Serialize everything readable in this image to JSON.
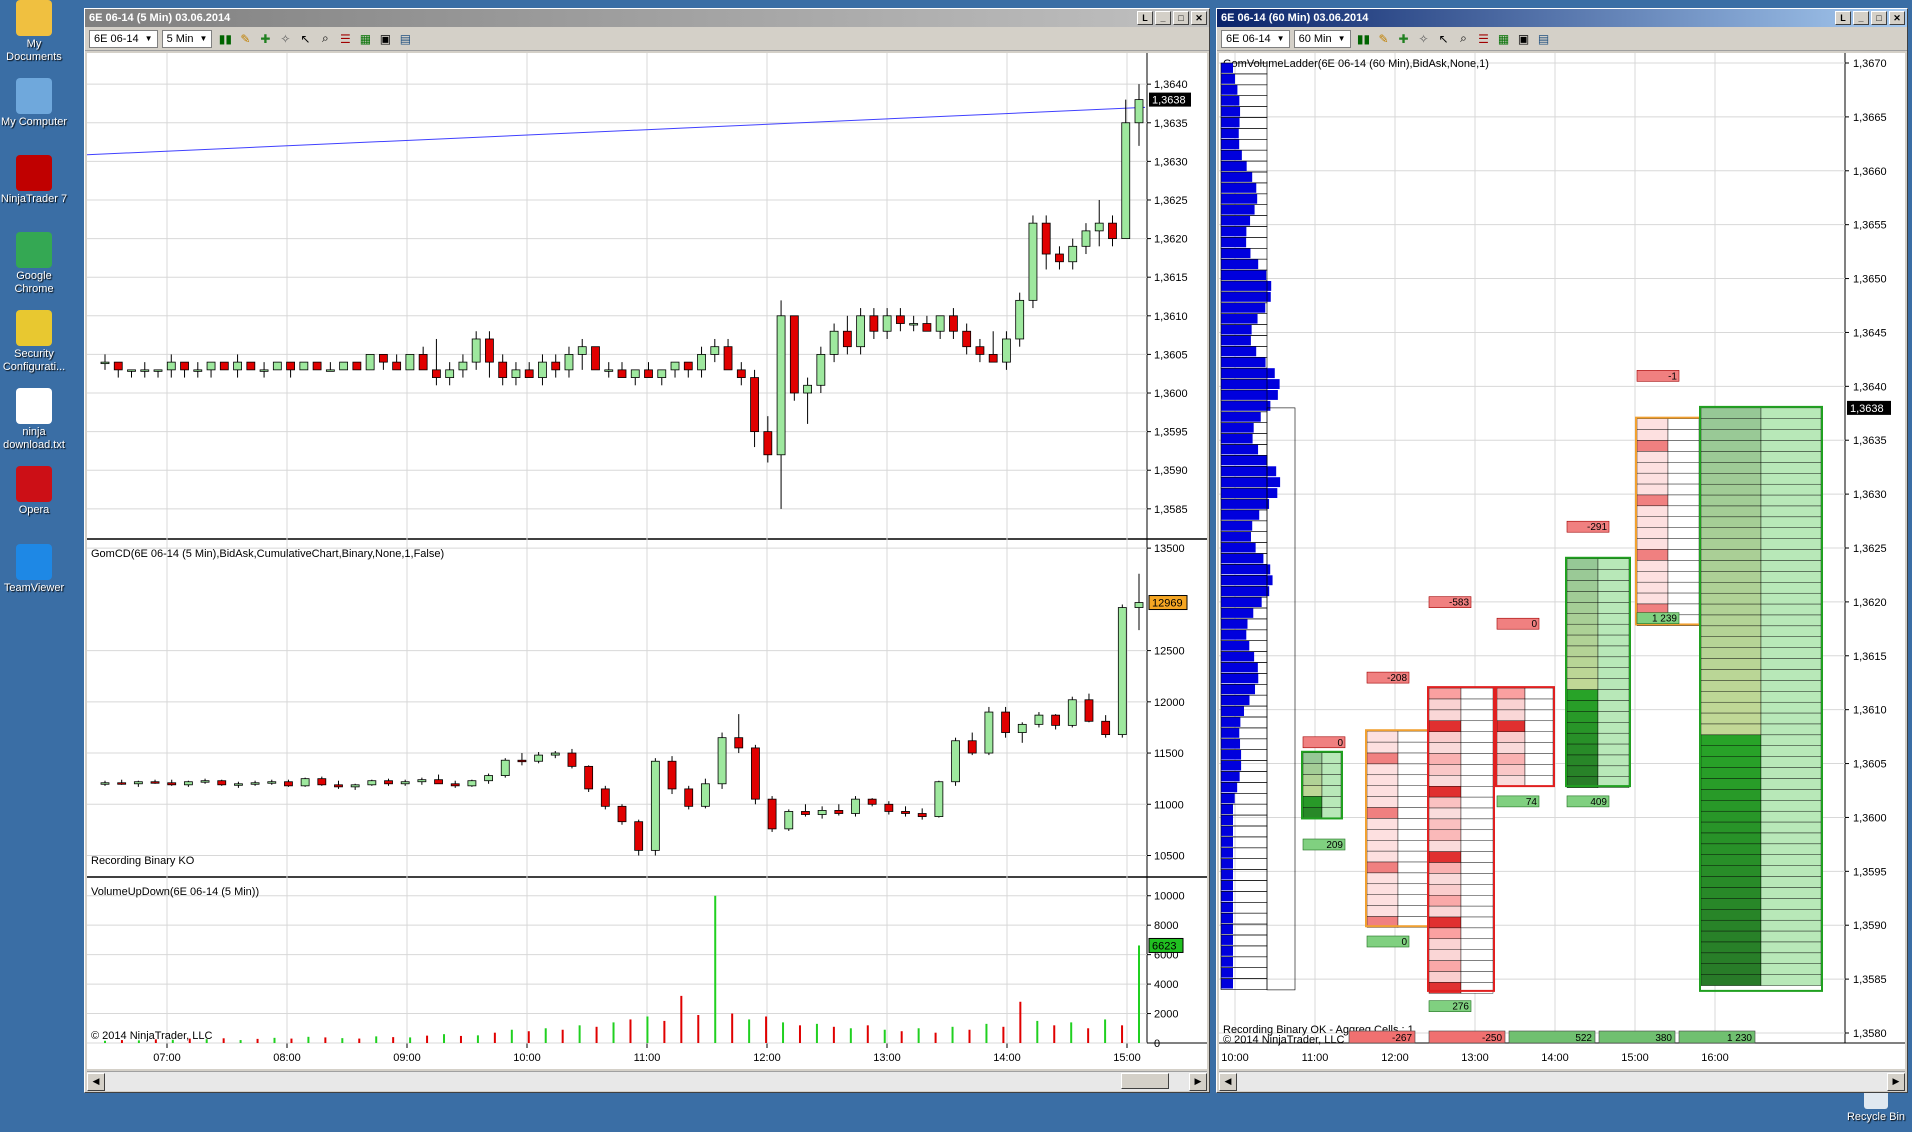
{
  "desktop": {
    "icons": [
      {
        "label": "My Documents",
        "color": "#f0c040",
        "top": -20
      },
      {
        "label": "My Computer",
        "color": "#6fa8dc",
        "top": 58
      },
      {
        "label": "NinjaTrader 7",
        "color": "#c00000",
        "top": 135
      },
      {
        "label": "Google Chrome",
        "color": "#34a853",
        "top": 212
      },
      {
        "label": "Security Configurati...",
        "color": "#e8c830",
        "top": 290
      },
      {
        "label": "ninja download.txt",
        "color": "#ffffff",
        "top": 368
      },
      {
        "label": "Opera",
        "color": "#cc0f16",
        "top": 446
      },
      {
        "label": "TeamViewer",
        "color": "#1e88e5",
        "top": 524
      }
    ],
    "recycle_bin": "Recycle Bin"
  },
  "left_window": {
    "title": "6E 06-14 (5 Min)  03.06.2014",
    "instrument": "6E 06-14",
    "interval": "5 Min",
    "price_panel": {
      "price_ticks": [
        "1,3640",
        "1,3635",
        "1,3630",
        "1,3625",
        "1,3620",
        "1,3615",
        "1,3610",
        "1,3605",
        "1,3600",
        "1,3595",
        "1,3590",
        "1,3585"
      ],
      "last_price": "1,3638",
      "ylim": [
        1.3582,
        1.3643
      ]
    },
    "cd_panel": {
      "label": "GomCD(6E 06-14 (5 Min),BidAsk,CumulativeChart,Binary,None,1,False)",
      "status": "Recording Binary KO",
      "ticks": [
        "13500",
        "12500",
        "12000",
        "11500",
        "11000",
        "10500"
      ],
      "last_value": "12969",
      "ylim": [
        10300,
        13550
      ]
    },
    "vol_panel": {
      "label": "VolumeUpDown(6E 06-14 (5 Min))",
      "ticks": [
        "10000",
        "8000",
        "6000",
        "4000",
        "2000",
        "0"
      ],
      "last_value": "6623",
      "copyright": "© 2014 NinjaTrader, LLC",
      "ylim": [
        0,
        11000
      ]
    },
    "time_labels": [
      "07:00",
      "08:00",
      "09:00",
      "10:00",
      "11:00",
      "12:00",
      "13:00",
      "14:00",
      "15:00"
    ]
  },
  "right_window": {
    "title": "6E 06-14 (60 Min)  03.06.2014",
    "instrument": "6E 06-14",
    "interval": "60 Min",
    "indicator_label": "GomVolumeLadder(6E 06-14 (60 Min),BidAsk,None,1)",
    "price_ticks": [
      "1,3670",
      "1,3665",
      "1,3660",
      "1,3655",
      "1,3650",
      "1,3645",
      "1,3640",
      "1,3635",
      "1,3630",
      "1,3625",
      "1,3620",
      "1,3615",
      "1,3610",
      "1,3605",
      "1,3600",
      "1,3595",
      "1,3590",
      "1,3585",
      "1,3580"
    ],
    "last_price": "1,3638",
    "status": "Recording Binary OK - Aggreg Cells : 1",
    "copyright": "© 2014 NinjaTrader, LLC",
    "time_labels": [
      "10:00",
      "11:00",
      "12:00",
      "13:00",
      "14:00",
      "15:00",
      "16:00"
    ],
    "bar_deltas": [
      "-267",
      "-250",
      "522",
      "380",
      "1 230"
    ],
    "top_deltas": [
      "0",
      "-208",
      "-583",
      "0",
      "-291",
      "-1"
    ],
    "bottom_deltas": [
      "209",
      "0",
      "276",
      "74",
      "409",
      "1 239"
    ]
  },
  "chart_data": {
    "type": "candlestick",
    "title": "6E 06-14 (5 Min)",
    "price_ohlc": [
      [
        1.3604,
        1.3605,
        1.3603,
        1.3604
      ],
      [
        1.3604,
        1.3604,
        1.3602,
        1.3603
      ],
      [
        1.3603,
        1.3603,
        1.3602,
        1.3603
      ],
      [
        1.3603,
        1.3604,
        1.3602,
        1.3603
      ],
      [
        1.3603,
        1.3603,
        1.3602,
        1.3603
      ],
      [
        1.3603,
        1.3605,
        1.3602,
        1.3604
      ],
      [
        1.3604,
        1.3604,
        1.3602,
        1.3603
      ],
      [
        1.3603,
        1.3604,
        1.3602,
        1.3603
      ],
      [
        1.3603,
        1.3604,
        1.3602,
        1.3604
      ],
      [
        1.3604,
        1.3604,
        1.3603,
        1.3603
      ],
      [
        1.3603,
        1.3605,
        1.3602,
        1.3604
      ],
      [
        1.3604,
        1.3604,
        1.3603,
        1.3603
      ],
      [
        1.3603,
        1.3604,
        1.3602,
        1.3603
      ],
      [
        1.3603,
        1.3604,
        1.3603,
        1.3604
      ],
      [
        1.3604,
        1.3604,
        1.3602,
        1.3603
      ],
      [
        1.3603,
        1.3604,
        1.3603,
        1.3604
      ],
      [
        1.3604,
        1.3604,
        1.3603,
        1.3603
      ],
      [
        1.3603,
        1.3604,
        1.3603,
        1.3603
      ],
      [
        1.3603,
        1.3604,
        1.3603,
        1.3604
      ],
      [
        1.3604,
        1.3604,
        1.3603,
        1.3603
      ],
      [
        1.3603,
        1.3605,
        1.3603,
        1.3605
      ],
      [
        1.3605,
        1.3605,
        1.3603,
        1.3604
      ],
      [
        1.3604,
        1.3605,
        1.3603,
        1.3603
      ],
      [
        1.3603,
        1.3605,
        1.3603,
        1.3605
      ],
      [
        1.3605,
        1.3606,
        1.3603,
        1.3603
      ],
      [
        1.3603,
        1.3607,
        1.3601,
        1.3602
      ],
      [
        1.3602,
        1.3604,
        1.3601,
        1.3603
      ],
      [
        1.3603,
        1.3605,
        1.3602,
        1.3604
      ],
      [
        1.3604,
        1.3608,
        1.3603,
        1.3607
      ],
      [
        1.3607,
        1.3608,
        1.3602,
        1.3604
      ],
      [
        1.3604,
        1.3605,
        1.3601,
        1.3602
      ],
      [
        1.3602,
        1.3604,
        1.3601,
        1.3603
      ],
      [
        1.3603,
        1.3604,
        1.3602,
        1.3602
      ],
      [
        1.3602,
        1.3605,
        1.3601,
        1.3604
      ],
      [
        1.3604,
        1.3605,
        1.3602,
        1.3603
      ],
      [
        1.3603,
        1.3606,
        1.3602,
        1.3605
      ],
      [
        1.3605,
        1.3607,
        1.3603,
        1.3606
      ],
      [
        1.3606,
        1.3606,
        1.3603,
        1.3603
      ],
      [
        1.3603,
        1.3604,
        1.3602,
        1.3603
      ],
      [
        1.3603,
        1.3604,
        1.3602,
        1.3602
      ],
      [
        1.3602,
        1.3603,
        1.3601,
        1.3603
      ],
      [
        1.3603,
        1.3604,
        1.3602,
        1.3602
      ],
      [
        1.3602,
        1.3603,
        1.3601,
        1.3603
      ],
      [
        1.3603,
        1.3604,
        1.3602,
        1.3604
      ],
      [
        1.3604,
        1.3604,
        1.3602,
        1.3603
      ],
      [
        1.3603,
        1.3606,
        1.3602,
        1.3605
      ],
      [
        1.3605,
        1.3607,
        1.3604,
        1.3606
      ],
      [
        1.3606,
        1.3607,
        1.3603,
        1.3603
      ],
      [
        1.3603,
        1.3604,
        1.3601,
        1.3602
      ],
      [
        1.3602,
        1.3603,
        1.3593,
        1.3595
      ],
      [
        1.3595,
        1.3597,
        1.3591,
        1.3592
      ],
      [
        1.3592,
        1.3612,
        1.3585,
        1.361
      ],
      [
        1.361,
        1.361,
        1.3599,
        1.36
      ],
      [
        1.36,
        1.3602,
        1.3596,
        1.3601
      ],
      [
        1.3601,
        1.3606,
        1.36,
        1.3605
      ],
      [
        1.3605,
        1.3609,
        1.3604,
        1.3608
      ],
      [
        1.3608,
        1.361,
        1.3605,
        1.3606
      ],
      [
        1.3606,
        1.3611,
        1.3605,
        1.361
      ],
      [
        1.361,
        1.3611,
        1.3607,
        1.3608
      ],
      [
        1.3608,
        1.3611,
        1.3607,
        1.361
      ],
      [
        1.361,
        1.3611,
        1.3608,
        1.3609
      ],
      [
        1.3609,
        1.361,
        1.3608,
        1.3609
      ],
      [
        1.3609,
        1.361,
        1.3608,
        1.3608
      ],
      [
        1.3608,
        1.361,
        1.3607,
        1.361
      ],
      [
        1.361,
        1.3611,
        1.3607,
        1.3608
      ],
      [
        1.3608,
        1.3609,
        1.3605,
        1.3606
      ],
      [
        1.3606,
        1.3607,
        1.3604,
        1.3605
      ],
      [
        1.3605,
        1.3608,
        1.3604,
        1.3604
      ],
      [
        1.3604,
        1.3608,
        1.3603,
        1.3607
      ],
      [
        1.3607,
        1.3613,
        1.3606,
        1.3612
      ],
      [
        1.3612,
        1.3623,
        1.3611,
        1.3622
      ],
      [
        1.3622,
        1.3623,
        1.3616,
        1.3618
      ],
      [
        1.3618,
        1.3619,
        1.3616,
        1.3617
      ],
      [
        1.3617,
        1.362,
        1.3616,
        1.3619
      ],
      [
        1.3619,
        1.3622,
        1.3618,
        1.3621
      ],
      [
        1.3621,
        1.3625,
        1.3619,
        1.3622
      ],
      [
        1.3622,
        1.3623,
        1.3619,
        1.362
      ],
      [
        1.362,
        1.3638,
        1.362,
        1.3635
      ],
      [
        1.3635,
        1.364,
        1.3632,
        1.3638
      ]
    ],
    "cd_ohlc": [
      [
        11200,
        11230,
        11180,
        11210
      ],
      [
        11210,
        11240,
        11190,
        11200
      ],
      [
        11200,
        11230,
        11170,
        11220
      ],
      [
        11220,
        11240,
        11200,
        11210
      ],
      [
        11210,
        11240,
        11180,
        11190
      ],
      [
        11190,
        11230,
        11170,
        11220
      ],
      [
        11220,
        11250,
        11200,
        11230
      ],
      [
        11230,
        11240,
        11180,
        11190
      ],
      [
        11190,
        11220,
        11160,
        11200
      ],
      [
        11200,
        11230,
        11180,
        11210
      ],
      [
        11210,
        11240,
        11190,
        11220
      ],
      [
        11220,
        11240,
        11170,
        11180
      ],
      [
        11180,
        11260,
        11170,
        11250
      ],
      [
        11250,
        11270,
        11180,
        11190
      ],
      [
        11190,
        11230,
        11150,
        11170
      ],
      [
        11170,
        11200,
        11140,
        11190
      ],
      [
        11190,
        11240,
        11180,
        11230
      ],
      [
        11230,
        11250,
        11180,
        11200
      ],
      [
        11200,
        11240,
        11180,
        11220
      ],
      [
        11220,
        11260,
        11190,
        11240
      ],
      [
        11240,
        11290,
        11200,
        11200
      ],
      [
        11200,
        11230,
        11160,
        11180
      ],
      [
        11180,
        11240,
        11170,
        11230
      ],
      [
        11230,
        11300,
        11200,
        11280
      ],
      [
        11280,
        11450,
        11260,
        11430
      ],
      [
        11430,
        11500,
        11380,
        11420
      ],
      [
        11420,
        11510,
        11400,
        11480
      ],
      [
        11480,
        11520,
        11450,
        11500
      ],
      [
        11500,
        11540,
        11350,
        11370
      ],
      [
        11370,
        11380,
        11120,
        11150
      ],
      [
        11150,
        11180,
        10950,
        10980
      ],
      [
        10980,
        11000,
        10800,
        10830
      ],
      [
        10830,
        10850,
        10500,
        10550
      ],
      [
        10550,
        11450,
        10500,
        11420
      ],
      [
        11420,
        11470,
        11100,
        11150
      ],
      [
        11150,
        11180,
        10950,
        10980
      ],
      [
        10980,
        11250,
        10960,
        11200
      ],
      [
        11200,
        11700,
        11150,
        11650
      ],
      [
        11650,
        11880,
        11500,
        11550
      ],
      [
        11550,
        11580,
        11000,
        11050
      ],
      [
        11050,
        11080,
        10730,
        10760
      ],
      [
        10760,
        10950,
        10740,
        10930
      ],
      [
        10930,
        11000,
        10880,
        10900
      ],
      [
        10900,
        10980,
        10860,
        10940
      ],
      [
        10940,
        11000,
        10890,
        10910
      ],
      [
        10910,
        11080,
        10880,
        11050
      ],
      [
        11050,
        11060,
        10980,
        11000
      ],
      [
        11000,
        11030,
        10900,
        10930
      ],
      [
        10930,
        10980,
        10880,
        10910
      ],
      [
        10910,
        10960,
        10850,
        10880
      ],
      [
        10880,
        11230,
        10870,
        11220
      ],
      [
        11220,
        11650,
        11180,
        11620
      ],
      [
        11620,
        11700,
        11480,
        11500
      ],
      [
        11500,
        11950,
        11480,
        11900
      ],
      [
        11900,
        11950,
        11650,
        11700
      ],
      [
        11700,
        11800,
        11600,
        11780
      ],
      [
        11780,
        11900,
        11750,
        11870
      ],
      [
        11870,
        11880,
        11730,
        11770
      ],
      [
        11770,
        12050,
        11750,
        12020
      ],
      [
        12020,
        12080,
        11800,
        11810
      ],
      [
        11810,
        11870,
        11650,
        11680
      ],
      [
        11680,
        12950,
        11650,
        12920
      ],
      [
        12920,
        13250,
        12700,
        12969
      ]
    ],
    "volume": [
      {
        "v": 150,
        "d": "up"
      },
      {
        "v": 200,
        "d": "dn"
      },
      {
        "v": 180,
        "d": "up"
      },
      {
        "v": 250,
        "d": "dn"
      },
      {
        "v": 220,
        "d": "up"
      },
      {
        "v": 300,
        "d": "dn"
      },
      {
        "v": 260,
        "d": "up"
      },
      {
        "v": 320,
        "d": "dn"
      },
      {
        "v": 200,
        "d": "up"
      },
      {
        "v": 280,
        "d": "dn"
      },
      {
        "v": 350,
        "d": "up"
      },
      {
        "v": 300,
        "d": "dn"
      },
      {
        "v": 420,
        "d": "up"
      },
      {
        "v": 380,
        "d": "dn"
      },
      {
        "v": 330,
        "d": "up"
      },
      {
        "v": 300,
        "d": "dn"
      },
      {
        "v": 450,
        "d": "up"
      },
      {
        "v": 400,
        "d": "dn"
      },
      {
        "v": 380,
        "d": "up"
      },
      {
        "v": 500,
        "d": "dn"
      },
      {
        "v": 600,
        "d": "up"
      },
      {
        "v": 480,
        "d": "dn"
      },
      {
        "v": 520,
        "d": "up"
      },
      {
        "v": 700,
        "d": "dn"
      },
      {
        "v": 900,
        "d": "up"
      },
      {
        "v": 800,
        "d": "dn"
      },
      {
        "v": 1000,
        "d": "up"
      },
      {
        "v": 900,
        "d": "dn"
      },
      {
        "v": 1200,
        "d": "up"
      },
      {
        "v": 1100,
        "d": "dn"
      },
      {
        "v": 1400,
        "d": "up"
      },
      {
        "v": 1600,
        "d": "dn"
      },
      {
        "v": 1800,
        "d": "up"
      },
      {
        "v": 1500,
        "d": "dn"
      },
      {
        "v": 3200,
        "d": "dn"
      },
      {
        "v": 1900,
        "d": "dn"
      },
      {
        "v": 10000,
        "d": "up"
      },
      {
        "v": 2000,
        "d": "dn"
      },
      {
        "v": 1600,
        "d": "up"
      },
      {
        "v": 1800,
        "d": "dn"
      },
      {
        "v": 1400,
        "d": "up"
      },
      {
        "v": 1200,
        "d": "dn"
      },
      {
        "v": 1300,
        "d": "up"
      },
      {
        "v": 1100,
        "d": "dn"
      },
      {
        "v": 1000,
        "d": "up"
      },
      {
        "v": 1200,
        "d": "dn"
      },
      {
        "v": 900,
        "d": "up"
      },
      {
        "v": 800,
        "d": "dn"
      },
      {
        "v": 1000,
        "d": "up"
      },
      {
        "v": 700,
        "d": "dn"
      },
      {
        "v": 1100,
        "d": "up"
      },
      {
        "v": 900,
        "d": "dn"
      },
      {
        "v": 1300,
        "d": "up"
      },
      {
        "v": 1100,
        "d": "dn"
      },
      {
        "v": 2800,
        "d": "dn"
      },
      {
        "v": 1500,
        "d": "up"
      },
      {
        "v": 1200,
        "d": "dn"
      },
      {
        "v": 1400,
        "d": "up"
      },
      {
        "v": 1000,
        "d": "dn"
      },
      {
        "v": 1600,
        "d": "up"
      },
      {
        "v": 1200,
        "d": "dn"
      },
      {
        "v": 6623,
        "d": "up"
      }
    ],
    "ladder_bars": [
      {
        "xi": 0,
        "top": 1.367,
        "bot": 1.3584,
        "kind": "profile"
      },
      {
        "xi": 1,
        "top": 1.3606,
        "bot": 1.36,
        "kind": "green"
      },
      {
        "xi": 2,
        "top": 1.3608,
        "bot": 1.359,
        "kind": "orange"
      },
      {
        "xi": 3,
        "top": 1.3612,
        "bot": 1.3584,
        "kind": "red"
      },
      {
        "xi": 4,
        "top": 1.3612,
        "bot": 1.3603,
        "kind": "red"
      },
      {
        "xi": 5,
        "top": 1.3624,
        "bot": 1.3603,
        "kind": "green"
      },
      {
        "xi": 6,
        "top": 1.3637,
        "bot": 1.3618,
        "kind": "orange"
      },
      {
        "xi": 7,
        "top": 1.3638,
        "bot": 1.3584,
        "kind": "green"
      }
    ]
  },
  "colors": {
    "up": "#9ee89e",
    "down": "#e00000",
    "price_line": "#4040ff",
    "profile": "#0000dd",
    "grid": "#d8d8d8"
  }
}
